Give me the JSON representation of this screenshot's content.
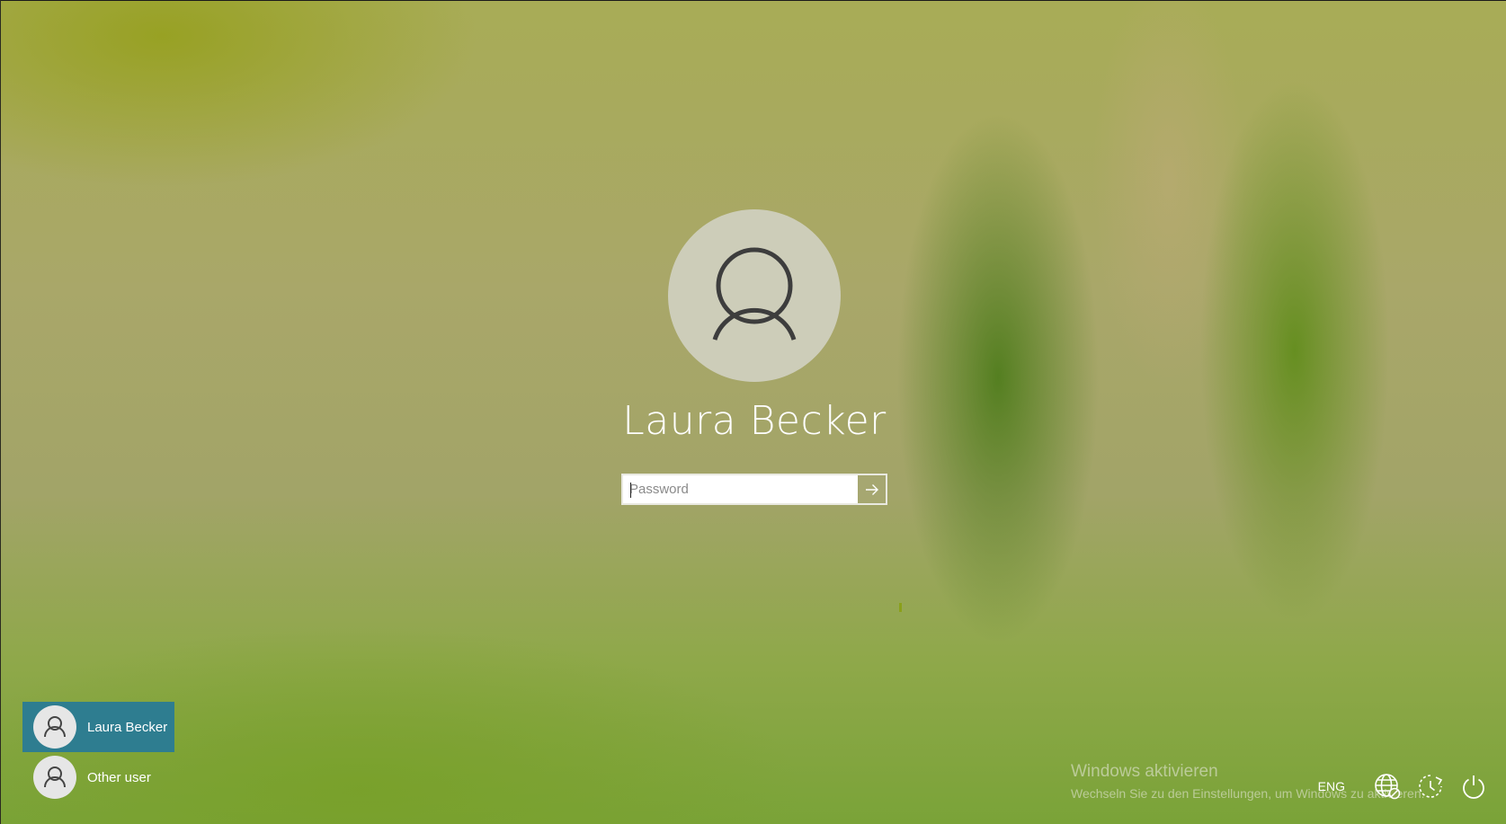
{
  "login": {
    "user_name": "Laura Becker",
    "password_placeholder": "Password"
  },
  "user_list": {
    "items": [
      {
        "label": "Laura Becker",
        "selected": true
      },
      {
        "label": "Other user",
        "selected": false
      }
    ]
  },
  "activation_watermark": {
    "title": "Windows aktivieren",
    "subtitle": "Wechseln Sie zu den Einstellungen, um Windows zu aktivieren."
  },
  "tray": {
    "language": "ENG",
    "icons": [
      "network-icon",
      "ease-of-access-icon",
      "power-icon"
    ]
  },
  "colors": {
    "selected_user_bg": "#2e7d90",
    "avatar_bg": "#cdcdb9"
  }
}
